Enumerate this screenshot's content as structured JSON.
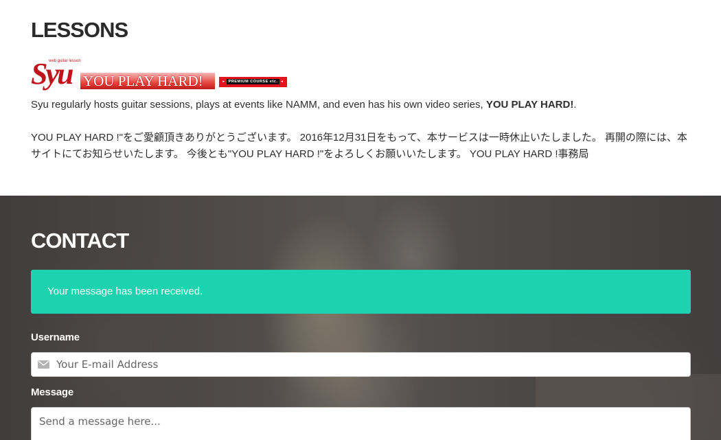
{
  "lessons": {
    "title": "LESSONS",
    "logo": {
      "brand": "Syu",
      "tagline": "web guitar lesson",
      "name": "YOU PLAY HARD!",
      "badge": "PREMIUM COURSE etc."
    },
    "intro_text": "Syu regularly hosts guitar sessions, plays at events like NAMM, and even has his own video series, ",
    "intro_bold": "YOU PLAY HARD!",
    "intro_end": ".",
    "notice": "YOU PLAY HARD !\"をご愛顧頂きありがとうございます。 2016年12月31日をもって、本サービスは一時休止いたしました。 再開の際には、本サイトにてお知らせいたします。 今後とも\"YOU PLAY HARD !\"をよろしくお願いいたします。 YOU PLAY HARD !事務局"
  },
  "contact": {
    "title": "CONTACT",
    "alert": "Your message has been received.",
    "username_label": "Username",
    "email_placeholder": "Your E-mail Address",
    "email_icon": "envelope-icon",
    "message_label": "Message",
    "message_placeholder": "Send a message here..."
  }
}
